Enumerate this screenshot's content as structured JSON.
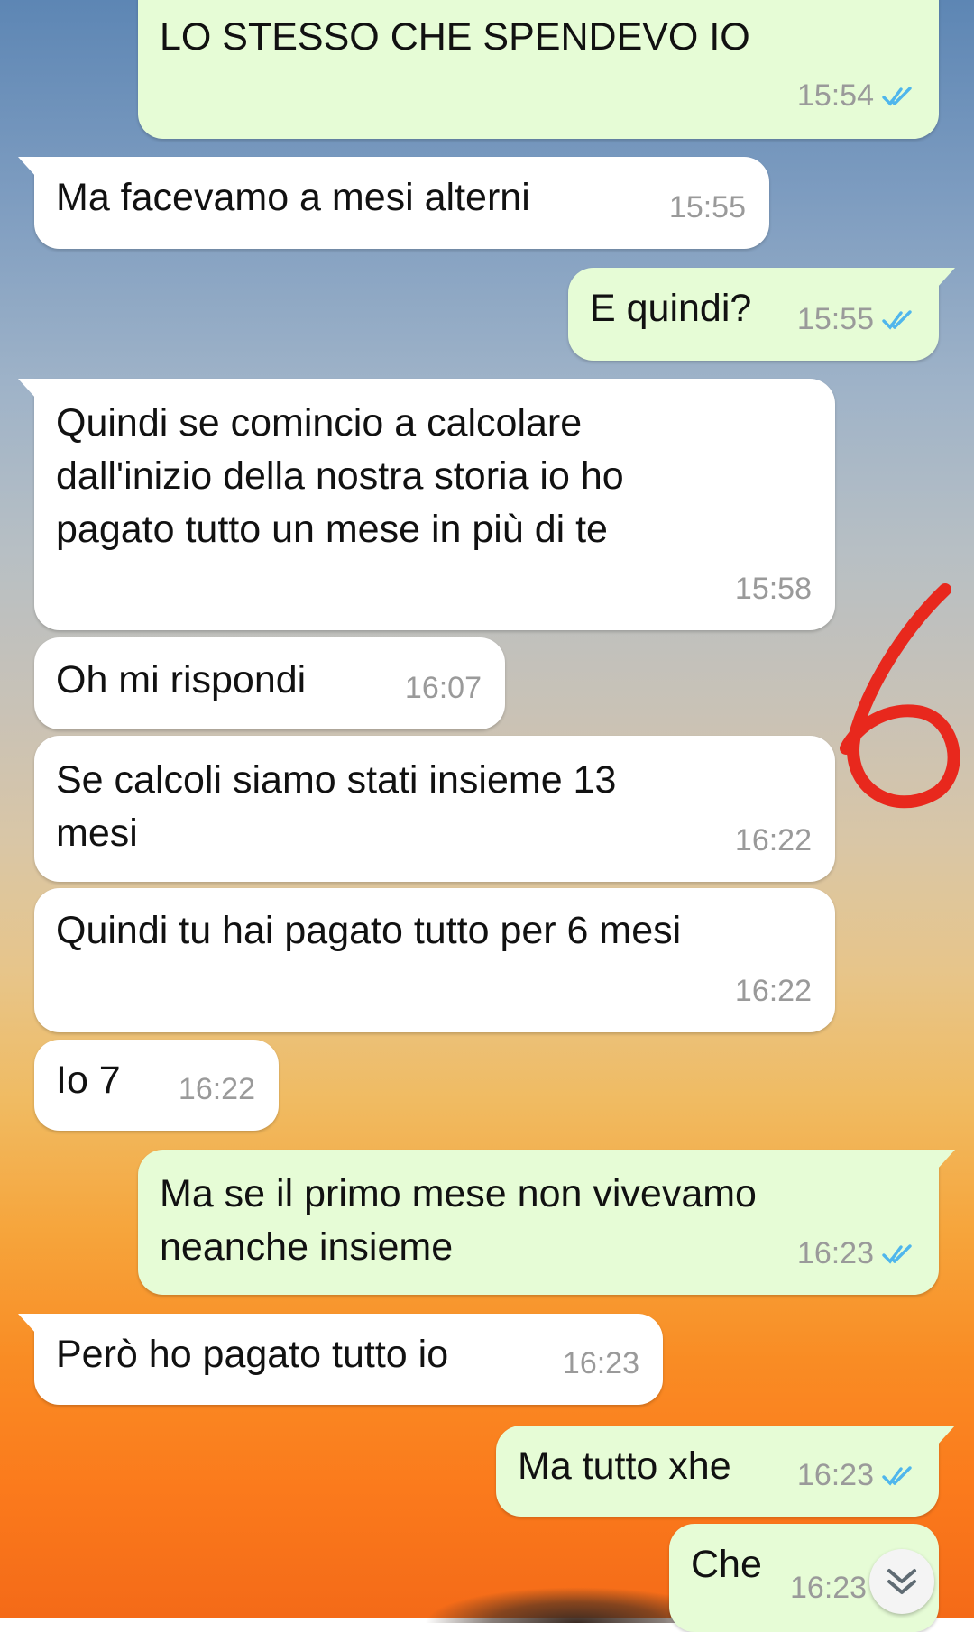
{
  "messages": [
    {
      "text": "LO STESSO CHE SPENDEVO IO",
      "time": "15:54",
      "direction": "outgoing",
      "status": "read"
    },
    {
      "text": "Ma facevamo a mesi alterni",
      "time": "15:55",
      "direction": "incoming"
    },
    {
      "text": "E quindi?",
      "time": "15:55",
      "direction": "outgoing",
      "status": "read"
    },
    {
      "text": "Quindi se comincio a calcolare\ndall'inizio della nostra storia io ho\npagato tutto un mese in più di te",
      "time": "15:58",
      "direction": "incoming"
    },
    {
      "text": "Oh mi rispondi",
      "time": "16:07",
      "direction": "incoming"
    },
    {
      "text": "Se calcoli siamo stati insieme 13\nmesi",
      "time": "16:22",
      "direction": "incoming"
    },
    {
      "text": "Quindi tu hai pagato tutto per 6 mesi",
      "time": "16:22",
      "direction": "incoming"
    },
    {
      "text": "Io 7",
      "time": "16:22",
      "direction": "incoming"
    },
    {
      "text": "Ma se il primo mese non vivevamo\nneanche insieme",
      "time": "16:23",
      "direction": "outgoing",
      "status": "read"
    },
    {
      "text": "Però ho pagato tutto io",
      "time": "16:23",
      "direction": "incoming"
    },
    {
      "text": "Ma tutto xhe",
      "time": "16:23",
      "direction": "outgoing",
      "status": "read"
    },
    {
      "text": "Che",
      "time": "16:23",
      "direction": "outgoing",
      "status": "read"
    }
  ],
  "icons": {
    "read_receipt": "double-check-icon",
    "scroll_down": "chevron-double-down-icon"
  },
  "colors": {
    "incoming_bubble": "#ffffff",
    "outgoing_bubble": "#e6fcd6",
    "timestamp": "#9a9a9a",
    "read_tick": "#4fb6ec",
    "annotation": "#e8281d"
  }
}
